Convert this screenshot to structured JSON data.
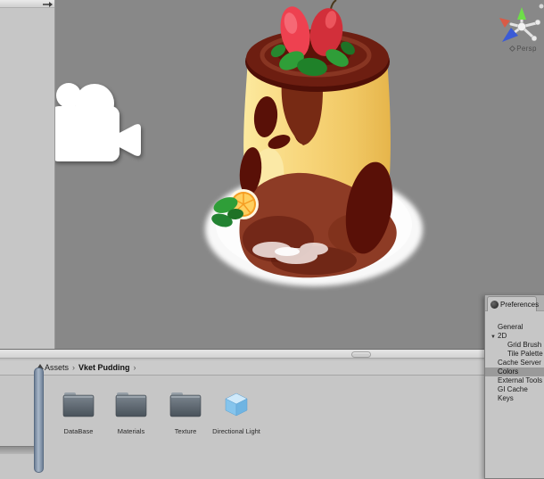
{
  "scene": {
    "view_label": "Persp",
    "model_name": "pudding-character",
    "background": "#888888"
  },
  "breadcrumb": {
    "root": "Assets",
    "current": "Vket Pudding",
    "separator": "›"
  },
  "project_items": [
    {
      "label": "DataBase",
      "type": "folder"
    },
    {
      "label": "Materials",
      "type": "folder"
    },
    {
      "label": "Texture",
      "type": "folder"
    },
    {
      "label": "Directional Light",
      "type": "cube"
    }
  ],
  "preferences": {
    "title": "Preferences",
    "foldout_glyph": "▼",
    "items": [
      {
        "label": "General",
        "indent": 0,
        "selected": false
      },
      {
        "label": "2D",
        "indent": 0,
        "selected": false,
        "foldout": true
      },
      {
        "label": "Grid Brush",
        "indent": 1,
        "selected": false
      },
      {
        "label": "Tile Palette",
        "indent": 1,
        "selected": false
      },
      {
        "label": "Cache Server",
        "indent": 0,
        "selected": false
      },
      {
        "label": "Colors",
        "indent": 0,
        "selected": true
      },
      {
        "label": "External Tools",
        "indent": 0,
        "selected": false
      },
      {
        "label": "GI Cache",
        "indent": 0,
        "selected": false
      },
      {
        "label": "Keys",
        "indent": 0,
        "selected": false
      }
    ]
  },
  "icons": {
    "camera": "camera-icon",
    "scene_gizmo": "axis-gizmo-icon",
    "folder": "folder-icon",
    "cube": "cube-icon",
    "collapse_arrow": "collapse-arrow-icon",
    "scroll_up": "scroll-up-arrow-icon",
    "preferences_badge": "preferences-circle-icon"
  },
  "colors": {
    "scene_bg": "#888888",
    "panel_bg": "#c6c6c6",
    "selection": "#9a9a9a",
    "folder": "#5a636c",
    "cube_blue": "#7bbde8",
    "scrollbar": "#8094ac",
    "pudding_body": "#f6d478",
    "caramel_cap": "#6d1e11",
    "caramel_pool": "#8d3b25",
    "strawberry": "#e23a46",
    "leaf": "#2f9e38",
    "plate": "#ffffff",
    "axis_x": "#d95b46",
    "axis_y": "#6ede48",
    "axis_z": "#3b5bd6"
  }
}
